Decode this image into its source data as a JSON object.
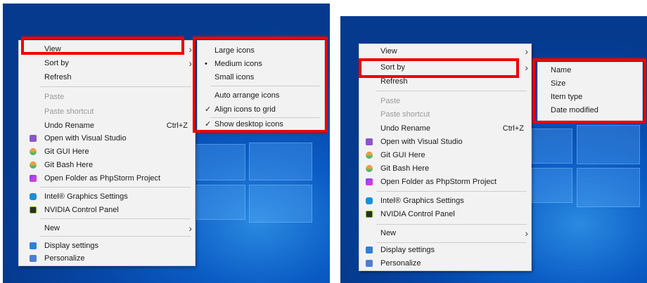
{
  "context_menu": {
    "items": [
      {
        "label": "View"
      },
      {
        "label": "Sort by"
      },
      {
        "label": "Refresh"
      },
      {
        "label": "Paste"
      },
      {
        "label": "Paste shortcut"
      },
      {
        "label": "Undo Rename",
        "shortcut": "Ctrl+Z"
      },
      {
        "label": "Open with Visual Studio",
        "icon": "visual-studio-icon"
      },
      {
        "label": "Git GUI Here",
        "icon": "git-gui-icon"
      },
      {
        "label": "Git Bash Here",
        "icon": "git-bash-icon"
      },
      {
        "label": "Open Folder as PhpStorm Project",
        "icon": "phpstorm-icon"
      },
      {
        "label": "Intel® Graphics Settings",
        "icon": "intel-graphics-icon"
      },
      {
        "label": "NVIDIA Control Panel",
        "icon": "nvidia-icon"
      },
      {
        "label": "New"
      },
      {
        "label": "Display settings",
        "icon": "display-settings-icon"
      },
      {
        "label": "Personalize",
        "icon": "personalize-icon"
      }
    ]
  },
  "view_submenu": {
    "items": [
      {
        "label": "Large icons"
      },
      {
        "label": "Medium icons",
        "mark": "•"
      },
      {
        "label": "Small icons"
      },
      {
        "label": "Auto arrange icons"
      },
      {
        "label": "Align icons to grid",
        "mark": "✓"
      },
      {
        "label": "Show desktop icons",
        "mark": "✓"
      }
    ]
  },
  "sortby_submenu": {
    "items": [
      {
        "label": "Name"
      },
      {
        "label": "Size"
      },
      {
        "label": "Item type"
      },
      {
        "label": "Date modified"
      }
    ]
  },
  "colors": {
    "highlight_border": "#ee0000",
    "menu_background": "#f2f2f2",
    "desktop_blue": "#0a5bc4"
  }
}
